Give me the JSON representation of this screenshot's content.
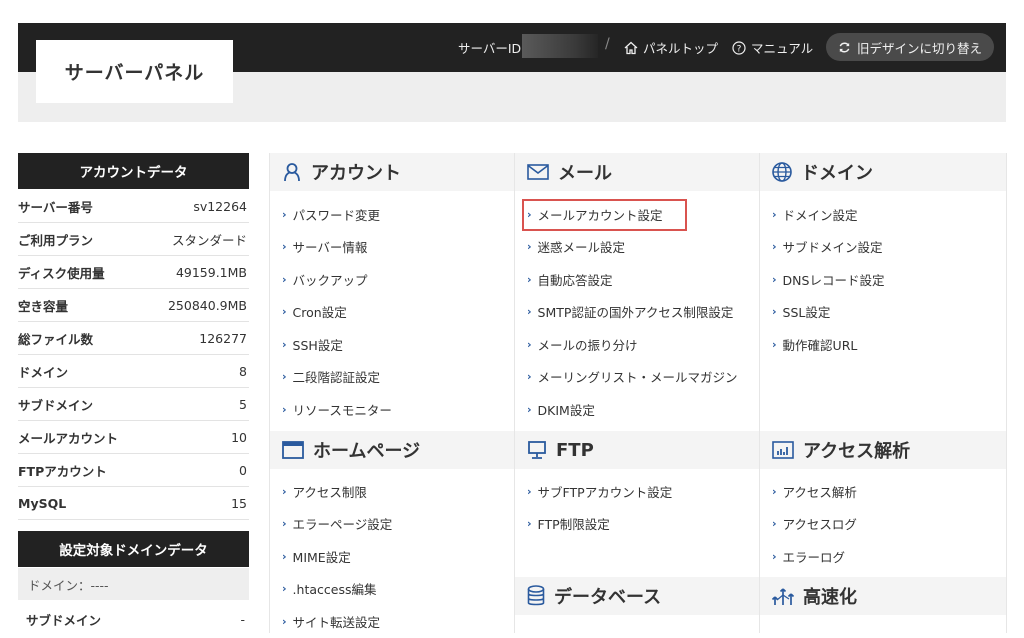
{
  "header": {
    "logo": "サーバーパネル",
    "server_id_label": "サーバーID",
    "slash": "/",
    "panel_top": "パネルトップ",
    "manual": "マニュアル",
    "old_design": "旧デザインに切り替え"
  },
  "account_data": {
    "title": "アカウントデータ",
    "rows": [
      {
        "key": "サーバー番号",
        "value": "sv12264"
      },
      {
        "key": "ご利用プラン",
        "value": "スタンダード"
      },
      {
        "key": "ディスク使用量",
        "value": "49159.1MB"
      },
      {
        "key": "空き容量",
        "value": "250840.9MB"
      },
      {
        "key": "総ファイル数",
        "value": "126277"
      },
      {
        "key": "ドメイン",
        "value": "8"
      },
      {
        "key": "サブドメイン",
        "value": "5"
      },
      {
        "key": "メールアカウント",
        "value": "10"
      },
      {
        "key": "FTPアカウント",
        "value": "0"
      },
      {
        "key": "MySQL",
        "value": "15"
      }
    ]
  },
  "domain_data": {
    "title": "設定対象ドメインデータ",
    "domain": "ドメイン：----",
    "subdomain_key": "サブドメイン",
    "subdomain_value": "-"
  },
  "sections": {
    "account": {
      "title": "アカウント",
      "icon": "person-icon",
      "items": [
        "パスワード変更",
        "サーバー情報",
        "バックアップ",
        "Cron設定",
        "SSH設定",
        "二段階認証設定",
        "リソースモニター"
      ]
    },
    "mail": {
      "title": "メール",
      "icon": "mail-icon",
      "items": [
        "メールアカウント設定",
        "迷惑メール設定",
        "自動応答設定",
        "SMTP認証の国外アクセス制限設定",
        "メールの振り分け",
        "メーリングリスト・メールマガジン",
        "DKIM設定"
      ]
    },
    "domain": {
      "title": "ドメイン",
      "icon": "globe-icon",
      "items": [
        "ドメイン設定",
        "サブドメイン設定",
        "DNSレコード設定",
        "SSL設定",
        "動作確認URL"
      ]
    },
    "homepage": {
      "title": "ホームページ",
      "icon": "window-icon",
      "items": [
        "アクセス制限",
        "エラーページ設定",
        "MIME設定",
        ".htaccess編集",
        "サイト転送設定"
      ]
    },
    "ftp": {
      "title": "FTP",
      "icon": "monitor-icon",
      "items": [
        "サブFTPアカウント設定",
        "FTP制限設定"
      ]
    },
    "analytics": {
      "title": "アクセス解析",
      "icon": "chart-icon",
      "items": [
        "アクセス解析",
        "アクセスログ",
        "エラーログ"
      ]
    },
    "database": {
      "title": "データベース",
      "icon": "database-icon",
      "items": []
    },
    "speed": {
      "title": "高速化",
      "icon": "speed-icon",
      "items": []
    }
  },
  "colors": {
    "topbar": "#222222",
    "highlight": "#d9534f",
    "chevron": "#2a5a9e"
  }
}
